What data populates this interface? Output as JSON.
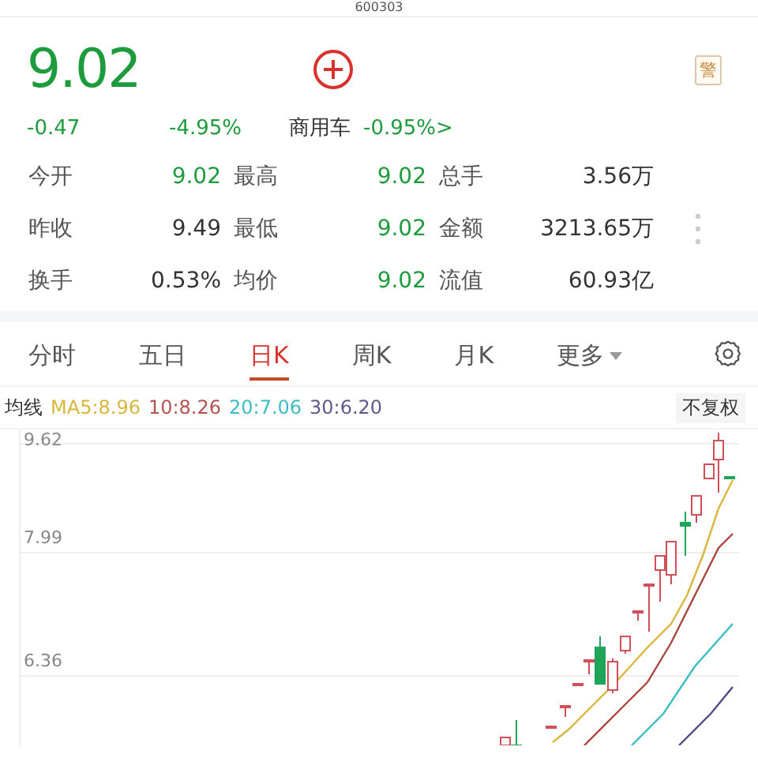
{
  "header": {
    "code": "600303"
  },
  "quote": {
    "price": "9.02",
    "change": "-0.47",
    "change_pct": "-4.95%",
    "sector": "商用车",
    "sector_change": "-0.95%>",
    "alert_badge": "警"
  },
  "stats": [
    {
      "label": "今开",
      "value": "9.02",
      "falling": true
    },
    {
      "label": "最高",
      "value": "9.02",
      "falling": true
    },
    {
      "label": "总手",
      "value": "3.56万",
      "falling": false
    },
    {
      "label": "昨收",
      "value": "9.49",
      "falling": false
    },
    {
      "label": "最低",
      "value": "9.02",
      "falling": true
    },
    {
      "label": "金额",
      "value": "3213.65万",
      "falling": false
    },
    {
      "label": "换手",
      "value": "0.53%",
      "falling": false
    },
    {
      "label": "均价",
      "value": "9.02",
      "falling": true
    },
    {
      "label": "流值",
      "value": "60.93亿",
      "falling": false
    }
  ],
  "tabs": [
    {
      "label": "分时",
      "selected": false
    },
    {
      "label": "五日",
      "selected": false
    },
    {
      "label": "日K",
      "selected": true
    },
    {
      "label": "周K",
      "selected": false
    },
    {
      "label": "月K",
      "selected": false
    },
    {
      "label": "更多",
      "selected": false,
      "kind": "dropdown"
    }
  ],
  "ma_legend": {
    "label": "均线",
    "items": [
      {
        "text": "MA5:8.96",
        "color": "#d9b63c"
      },
      {
        "text": "10:8.26",
        "color": "#b5524f"
      },
      {
        "text": "20:7.06",
        "color": "#3bbdc2"
      },
      {
        "text": "30:6.20",
        "color": "#5c5a8c"
      }
    ]
  },
  "adjust_button": "不复权",
  "chart": {
    "y_labels": [
      "9.62",
      "7.99",
      "6.36"
    ]
  }
}
